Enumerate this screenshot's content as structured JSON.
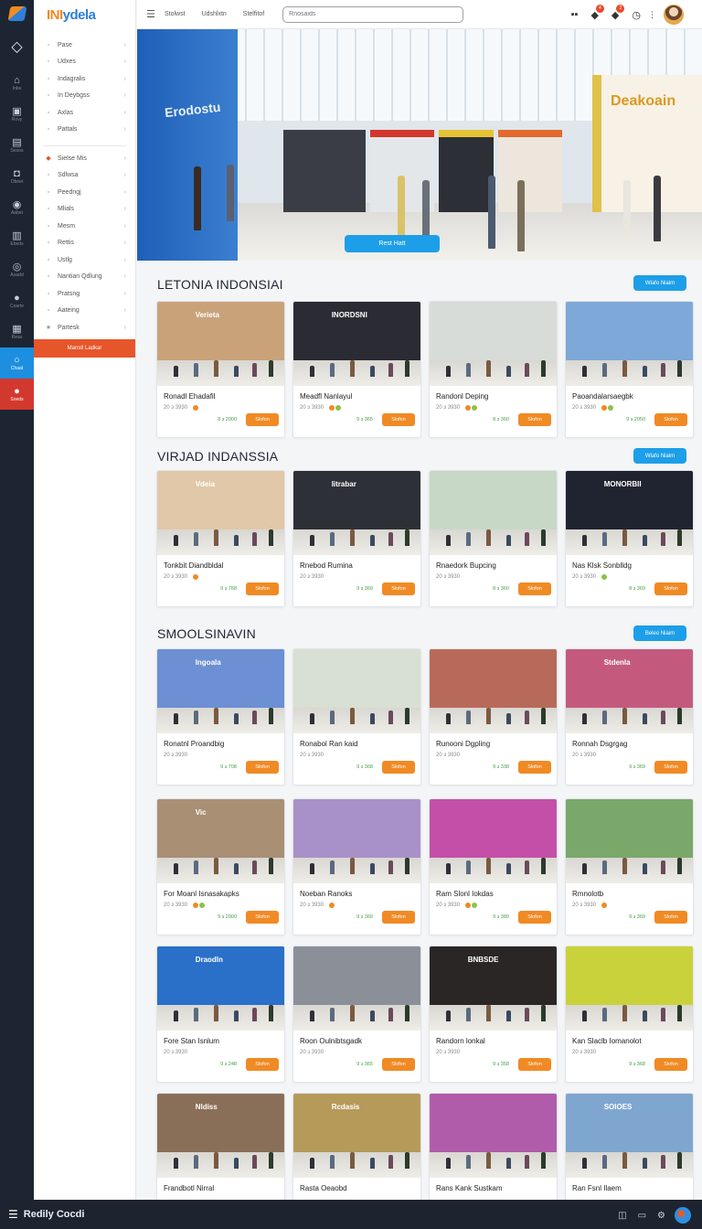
{
  "app": {
    "brand_part1": "INI",
    "brand_part2": "ydela"
  },
  "colors": {
    "accent_blue": "#1d9ee8",
    "accent_orange": "#f08a24",
    "accent_red": "#e7552a",
    "rail_bg": "#1e2532"
  },
  "rail": [
    {
      "icon": "diamond-icon",
      "glyph": "◇",
      "label": ""
    },
    {
      "icon": "home-icon",
      "glyph": "⌂",
      "label": "Inbe"
    },
    {
      "icon": "inbox-icon",
      "glyph": "▣",
      "label": "Rovy"
    },
    {
      "icon": "document-icon",
      "glyph": "▤",
      "label": "Seoos"
    },
    {
      "icon": "camera-icon",
      "glyph": "◘",
      "label": "Oboet"
    },
    {
      "icon": "globe-icon",
      "glyph": "◉",
      "label": "Aabet"
    },
    {
      "icon": "store-icon",
      "glyph": "▥",
      "label": "Ebeds"
    },
    {
      "icon": "location-icon",
      "glyph": "◎",
      "label": "Aoadd"
    },
    {
      "icon": "planet-icon",
      "glyph": "●",
      "label": "Coarte"
    },
    {
      "icon": "chart-icon",
      "glyph": "▦",
      "label": "Reas"
    },
    {
      "icon": "chat-icon",
      "glyph": "○",
      "label": "Chaat"
    },
    {
      "icon": "leaf-icon",
      "glyph": "●",
      "label": "Soeds"
    }
  ],
  "nav": {
    "group1": [
      {
        "label": "Pase",
        "icon": "grid-icon",
        "glyph": "▫"
      },
      {
        "label": "Udxes",
        "icon": "list-icon",
        "glyph": "▫"
      },
      {
        "label": "Indagralis",
        "icon": "tag-icon",
        "glyph": "▫"
      },
      {
        "label": "In Deybgss",
        "icon": "box-icon",
        "glyph": "▫"
      },
      {
        "label": "Axlas",
        "icon": "user-icon",
        "glyph": "▫"
      },
      {
        "label": "Pattals",
        "icon": "file-icon",
        "glyph": "▫"
      }
    ],
    "group2": [
      {
        "label": "Sielse Mis",
        "icon": "flame-icon",
        "glyph": "◆"
      },
      {
        "label": "Sdlwsa",
        "icon": "cart-icon",
        "glyph": "▫"
      },
      {
        "label": "Peedngj",
        "icon": "bag-icon",
        "glyph": "▫"
      },
      {
        "label": "Mlials",
        "icon": "folder-icon",
        "glyph": "▫"
      },
      {
        "label": "Mesm",
        "icon": "bell-icon",
        "glyph": "▫"
      },
      {
        "label": "Rettis",
        "icon": "doc-icon",
        "glyph": "▫"
      },
      {
        "label": "Ustlg",
        "icon": "settings-icon",
        "glyph": "▫"
      },
      {
        "label": "Nantian Qdlung",
        "icon": "globe-icon",
        "glyph": "▫"
      },
      {
        "label": "Pratsng",
        "icon": "clock-icon",
        "glyph": "▫"
      },
      {
        "label": "Aateing",
        "icon": "edit-icon",
        "glyph": "▫"
      },
      {
        "label": "Partesk",
        "icon": "star-icon",
        "glyph": "★"
      }
    ],
    "cta": "Manstl Ladkar"
  },
  "topbar": {
    "links": [
      "Stolwst",
      "Udshlxtn",
      "Stelfitof"
    ],
    "search_placeholder": "Rnosaids",
    "badge1": "4",
    "badge2": "2"
  },
  "hero": {
    "left_sign": "Erodostu",
    "right_sign": "Deakoain",
    "button": "Rest Hatt"
  },
  "sections": [
    {
      "title": "LETONIA INDONSIAI",
      "pill": "Wlafo Niaim",
      "cards": [
        {
          "name": "Ronadl Ehadafil",
          "meta": "20 ɜ 3930",
          "price": "8 ɜ 2000",
          "buy": "Slofon",
          "sign": "Verieta",
          "bg": "#c9a27a",
          "dots": [
            "#f08a24"
          ]
        },
        {
          "name": "Meadfl Nanlayul",
          "meta": "20 ɜ 3930",
          "price": "9 ɜ 365",
          "buy": "Slofon",
          "sign": "INORDSNI",
          "bg": "#2a2b33",
          "dots": [
            "#f08a24",
            "#8bc34a"
          ]
        },
        {
          "name": "Randonl Deping",
          "meta": "20 ɜ 3930",
          "price": "8 ɜ 360",
          "buy": "Slofon",
          "sign": "",
          "bg": "#d8dcd8",
          "dots": [
            "#f08a24",
            "#8bc34a"
          ]
        },
        {
          "name": "Paoandalarsaegbk",
          "meta": "20 ɜ 3930",
          "price": "9 ɜ 2050",
          "buy": "Slofon",
          "sign": "",
          "bg": "#7ea8d8",
          "dots": [
            "#f08a24",
            "#8bc34a"
          ]
        }
      ]
    },
    {
      "title": "VIRJAD INDANSSIA",
      "pill": "Wlafo Niaim",
      "cards": [
        {
          "name": "Tonkbit Diandbldal",
          "meta": "20 ɜ 3930",
          "price": "9 ɜ 768",
          "buy": "Slofon",
          "sign": "Vdeia",
          "bg": "#e0c8a8",
          "dots": [
            "#f08a24"
          ]
        },
        {
          "name": "Rnebod Rumina",
          "meta": "20 ɜ 3930",
          "price": "9 ɜ 369",
          "buy": "Slofon",
          "sign": "Iitrabar",
          "bg": "#2e3038",
          "dots": []
        },
        {
          "name": "Rnaedork Bupcing",
          "meta": "20 ɜ 3930",
          "price": "8 ɜ 360",
          "buy": "Slofon",
          "sign": "",
          "bg": "#c7d8c6",
          "dots": []
        },
        {
          "name": "Nas Klsk Sonblldg",
          "meta": "20 ɜ 3930",
          "price": "8 ɜ 369",
          "buy": "Slofon",
          "sign": "MONORBII",
          "bg": "#1f2430",
          "dots": [
            "#8bc34a"
          ]
        }
      ]
    },
    {
      "title": "SMOOLSINAVIN",
      "pill": "Beleo Niaim",
      "cards": [
        {
          "name": "Ronatnl Proandbig",
          "meta": "20 ɜ 3930",
          "price": "9 ɜ 708",
          "buy": "Slofon",
          "sign": "Ingoala",
          "bg": "#6d8fd3",
          "dots": []
        },
        {
          "name": "Ronabol Ran kaid",
          "meta": "20 ɜ 3930",
          "price": "9 ɜ 368",
          "buy": "Slofon",
          "sign": "",
          "bg": "#d8e0d4",
          "dots": []
        },
        {
          "name": "Runooni Dgpling",
          "meta": "20 ɜ 3930",
          "price": "9 ɜ 338",
          "buy": "Slofon",
          "sign": "",
          "bg": "#b86a5a",
          "dots": []
        },
        {
          "name": "Ronnah Dsgrgag",
          "meta": "20 ɜ 3930",
          "price": "9 ɜ 369",
          "buy": "Slofon",
          "sign": "Stdenla",
          "bg": "#c35a7e",
          "dots": []
        },
        {
          "name": "For Moanl Isnasakapks",
          "meta": "20 ɜ 3930",
          "price": "9 ɜ 2000",
          "buy": "Slofon",
          "sign": "Vic",
          "bg": "#a98f74",
          "dots": [
            "#f08a24",
            "#8bc34a"
          ]
        },
        {
          "name": "Noeban Ranoks",
          "meta": "20 ɜ 3930",
          "price": "9 ɜ 360",
          "buy": "Slofon",
          "sign": "",
          "bg": "#a891c8",
          "dots": [
            "#f08a24"
          ]
        },
        {
          "name": "Ram Slonl Iokdas",
          "meta": "20 ɜ 3930",
          "price": "9 ɜ 380",
          "buy": "Slofon",
          "sign": "",
          "bg": "#c44fa8",
          "dots": [
            "#f08a24",
            "#8bc34a"
          ]
        },
        {
          "name": "Rmnolotb",
          "meta": "20 ɜ 3930",
          "price": "9 ɜ 369",
          "buy": "Slofon",
          "sign": "",
          "bg": "#7aa86a",
          "dots": [
            "#f08a24"
          ]
        },
        {
          "name": "Fore Stan Isnlum",
          "meta": "20 ɜ 3930",
          "price": "9 ɜ 248",
          "buy": "Slofon",
          "sign": "Draodln",
          "bg": "#2a6fc8",
          "dots": []
        },
        {
          "name": "Roon Oulnibtsgadk",
          "meta": "20 ɜ 3930",
          "price": "9 ɜ 365",
          "buy": "Slofon",
          "sign": "",
          "bg": "#8b8f98",
          "dots": []
        },
        {
          "name": "Randorn lonkal",
          "meta": "20 ɜ 3930",
          "price": "9 ɜ 358",
          "buy": "Slofon",
          "sign": "BNBSDE",
          "bg": "#2b2626",
          "dots": []
        },
        {
          "name": "Kan Slaclb Iomanolot",
          "meta": "20 ɜ 3930",
          "price": "9 ɜ 368",
          "buy": "Slofon",
          "sign": "",
          "bg": "#c9d23a",
          "dots": []
        },
        {
          "name": "Frandbotl Nirral",
          "meta": "",
          "price": "",
          "buy": "",
          "sign": "Nldiss",
          "bg": "#8a6f58",
          "dots": []
        },
        {
          "name": "Rasta Oeaobd",
          "meta": "",
          "price": "",
          "buy": "",
          "sign": "Rcdasis",
          "bg": "#b59a5a",
          "dots": []
        },
        {
          "name": "Rans Kank Sustkam",
          "meta": "",
          "price": "",
          "buy": "",
          "sign": "",
          "bg": "#b05caa",
          "dots": []
        },
        {
          "name": "Ran Fsnl Ilaem",
          "meta": "",
          "price": "",
          "buy": "",
          "sign": "SOIOES",
          "bg": "#7fa6cf",
          "dots": []
        }
      ]
    }
  ],
  "footer": {
    "text": "Redily Cocdi"
  }
}
